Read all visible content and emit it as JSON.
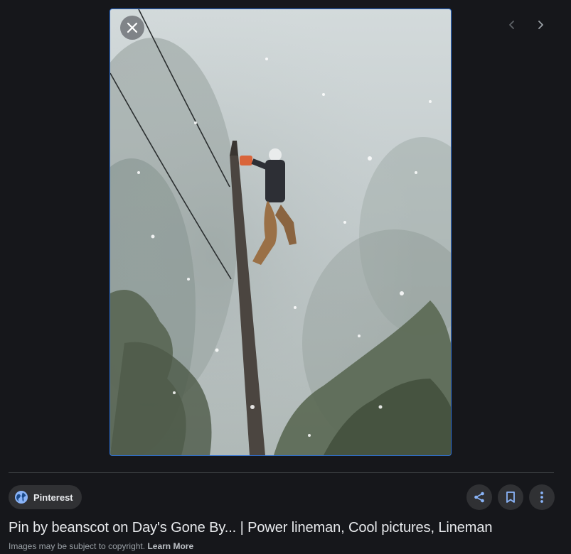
{
  "viewer": {
    "image_alt": "Lineman climbing a utility pole in a snowstorm",
    "close_icon": "close-icon",
    "prev_icon": "chevron-left-icon",
    "next_icon": "chevron-right-icon"
  },
  "source": {
    "name": "Pinterest",
    "icon": "globe-icon",
    "icon_color": "#8ab4f8"
  },
  "actions": {
    "share_icon": "share-icon",
    "save_icon": "bookmark-icon",
    "more_icon": "more-vert-icon",
    "icon_color": "#8ab4f8"
  },
  "title": "Pin by beanscot on Day's Gone By... | Power lineman, Cool pictures, Lineman",
  "copyright": {
    "text": "Images may be subject to copyright.",
    "link": "Learn More"
  },
  "colors": {
    "background": "#16171b",
    "frame_border": "#2b6fd6",
    "chip_background": "#303134"
  }
}
